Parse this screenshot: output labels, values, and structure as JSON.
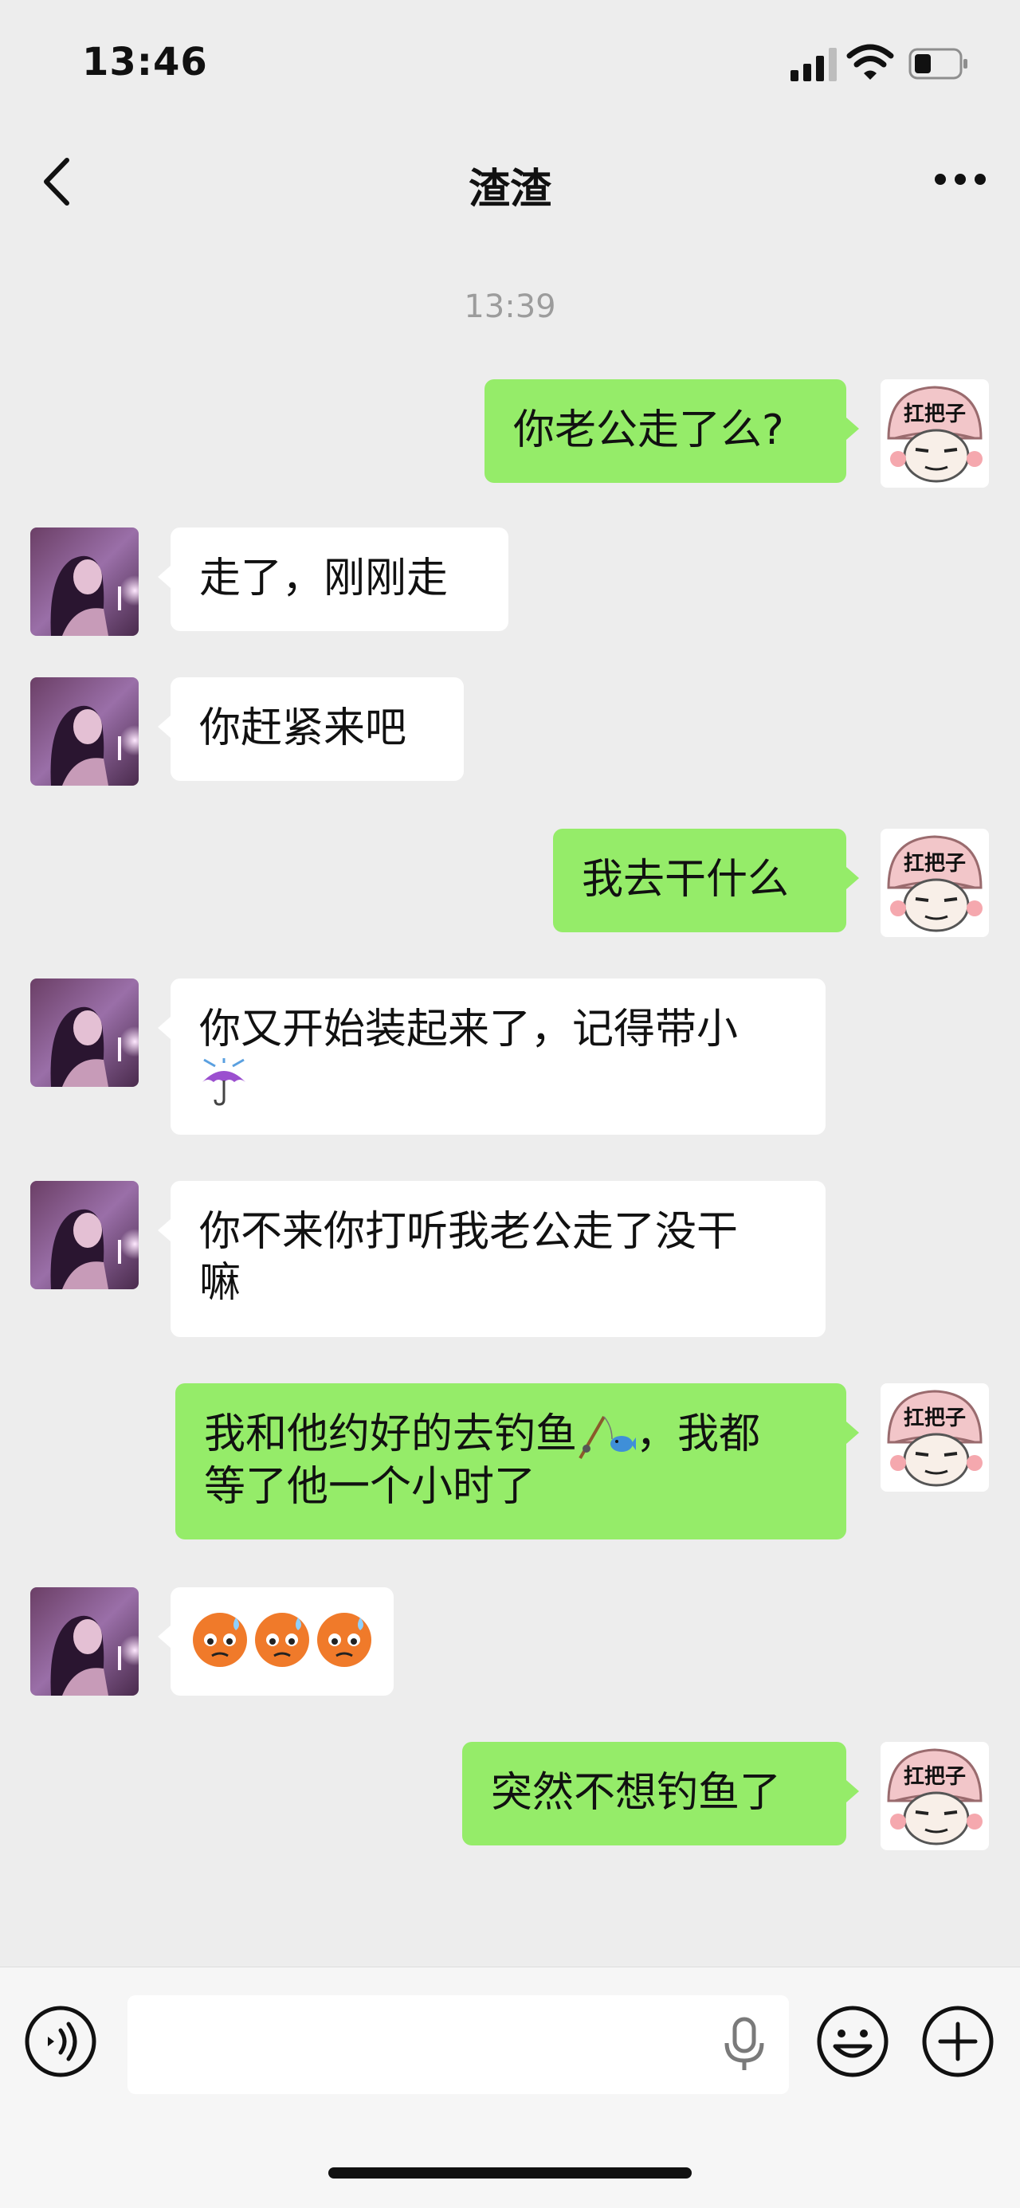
{
  "status_bar": {
    "time": "13:46"
  },
  "header": {
    "title": "渣渣"
  },
  "timestamp": "13:39",
  "colors": {
    "outgoing_bubble": "#95ec69",
    "incoming_bubble": "#ffffff",
    "background": "#ededed"
  },
  "messages": [
    {
      "direction": "out",
      "text": "你老公走了么?"
    },
    {
      "direction": "in",
      "text": "走了，刚刚走"
    },
    {
      "direction": "in",
      "text": "你赶紧来吧"
    },
    {
      "direction": "out",
      "text": "我去干什么"
    },
    {
      "direction": "in",
      "line1": "你又开始装起来了，记得带小",
      "emoji": "umbrella-emoji"
    },
    {
      "direction": "in",
      "line1": "你不来你打听我老公走了没干",
      "line2": "嘛"
    },
    {
      "direction": "out",
      "line1a": "我和他约好的去钓鱼",
      "emoji": "fishing-pole-emoji",
      "line1b": "，我都",
      "line2": "等了他一个小时了"
    },
    {
      "direction": "in",
      "emoji": "anxious-face-emoji ×3"
    },
    {
      "direction": "out",
      "text": "突然不想钓鱼了"
    }
  ],
  "avatars": {
    "outgoing_caption": "扛把子",
    "incoming": "woman-with-candle-photo"
  },
  "input": {
    "value": "",
    "placeholder": ""
  },
  "icons": [
    "back-icon",
    "more-icon",
    "voice-icon",
    "mic-icon",
    "emoji-icon",
    "add-icon"
  ]
}
